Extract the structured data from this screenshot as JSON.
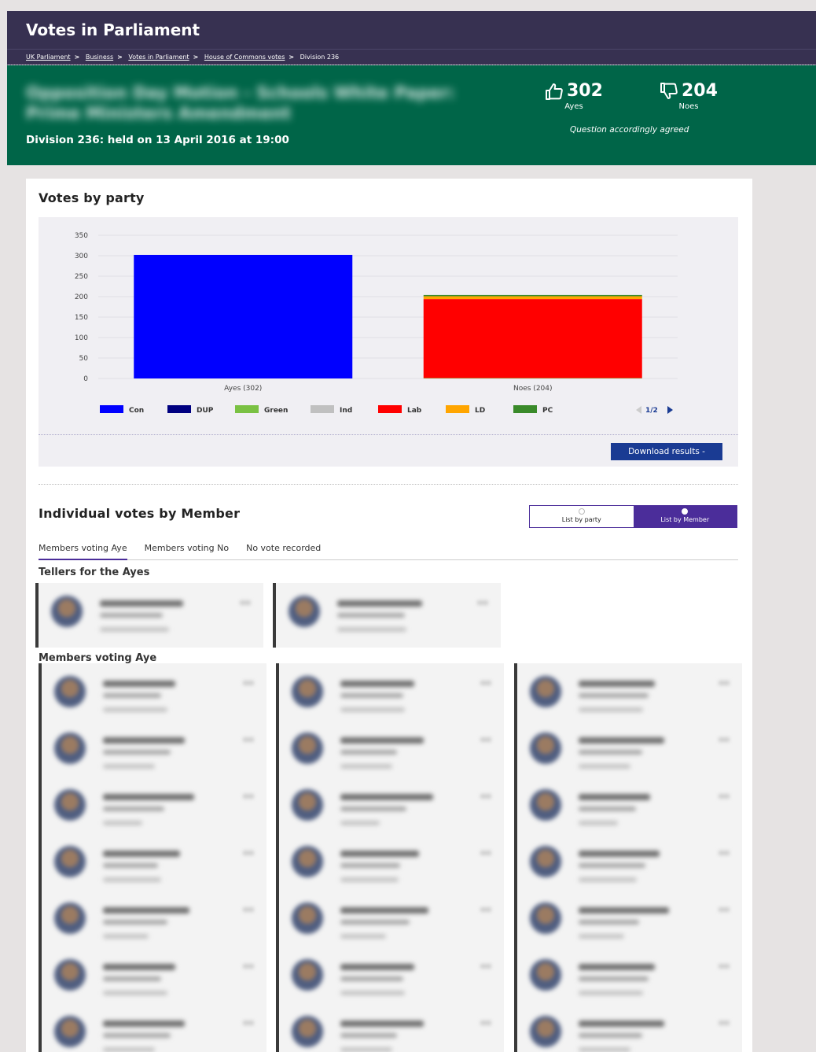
{
  "header": {
    "title": "Votes in Parliament"
  },
  "breadcrumb": [
    "UK Parliament",
    "Business",
    "Votes in Parliament",
    "House of Commons votes",
    "Division 236"
  ],
  "division": {
    "motion_title": "Opposition Day Motion - Schools White Paper: Prime Ministers Amendment",
    "subtitle": "Division 236: held on 13 April 2016 at 19:00",
    "ayes_count": "302",
    "ayes_label": "Ayes",
    "noes_count": "204",
    "noes_label": "Noes",
    "result": "Question accordingly agreed"
  },
  "votes_by_party": {
    "heading": "Votes by party",
    "download_label": "Download results -",
    "legend_page": "1/2"
  },
  "chart_data": {
    "type": "bar",
    "stacked": true,
    "categories": [
      "Ayes (302)",
      "Noes (204)"
    ],
    "series": [
      {
        "name": "Con",
        "values": [
          302,
          0
        ],
        "color": "#0000ff"
      },
      {
        "name": "DUP",
        "values": [
          0,
          0
        ],
        "color": "#000080"
      },
      {
        "name": "Green",
        "values": [
          0,
          1
        ],
        "color": "#7ac143"
      },
      {
        "name": "Ind",
        "values": [
          0,
          0
        ],
        "color": "#c0c0c0"
      },
      {
        "name": "Lab",
        "values": [
          0,
          193
        ],
        "color": "#ff0000"
      },
      {
        "name": "LD",
        "values": [
          0,
          7
        ],
        "color": "#ffa500"
      },
      {
        "name": "PC",
        "values": [
          0,
          3
        ],
        "color": "#3a8a2a"
      }
    ],
    "y_ticks": [
      0,
      50,
      100,
      150,
      200,
      250,
      300,
      350
    ],
    "ylim": [
      0,
      350
    ],
    "grid": true,
    "legend_position": "bottom"
  },
  "individual": {
    "heading": "Individual votes by Member",
    "toggle_party": "List by party",
    "toggle_member": "List by Member",
    "tabs": [
      "Members voting Aye",
      "Members voting No",
      "No vote recorded"
    ],
    "tellers_heading": "Tellers for the Ayes",
    "members_heading": "Members voting Aye"
  }
}
